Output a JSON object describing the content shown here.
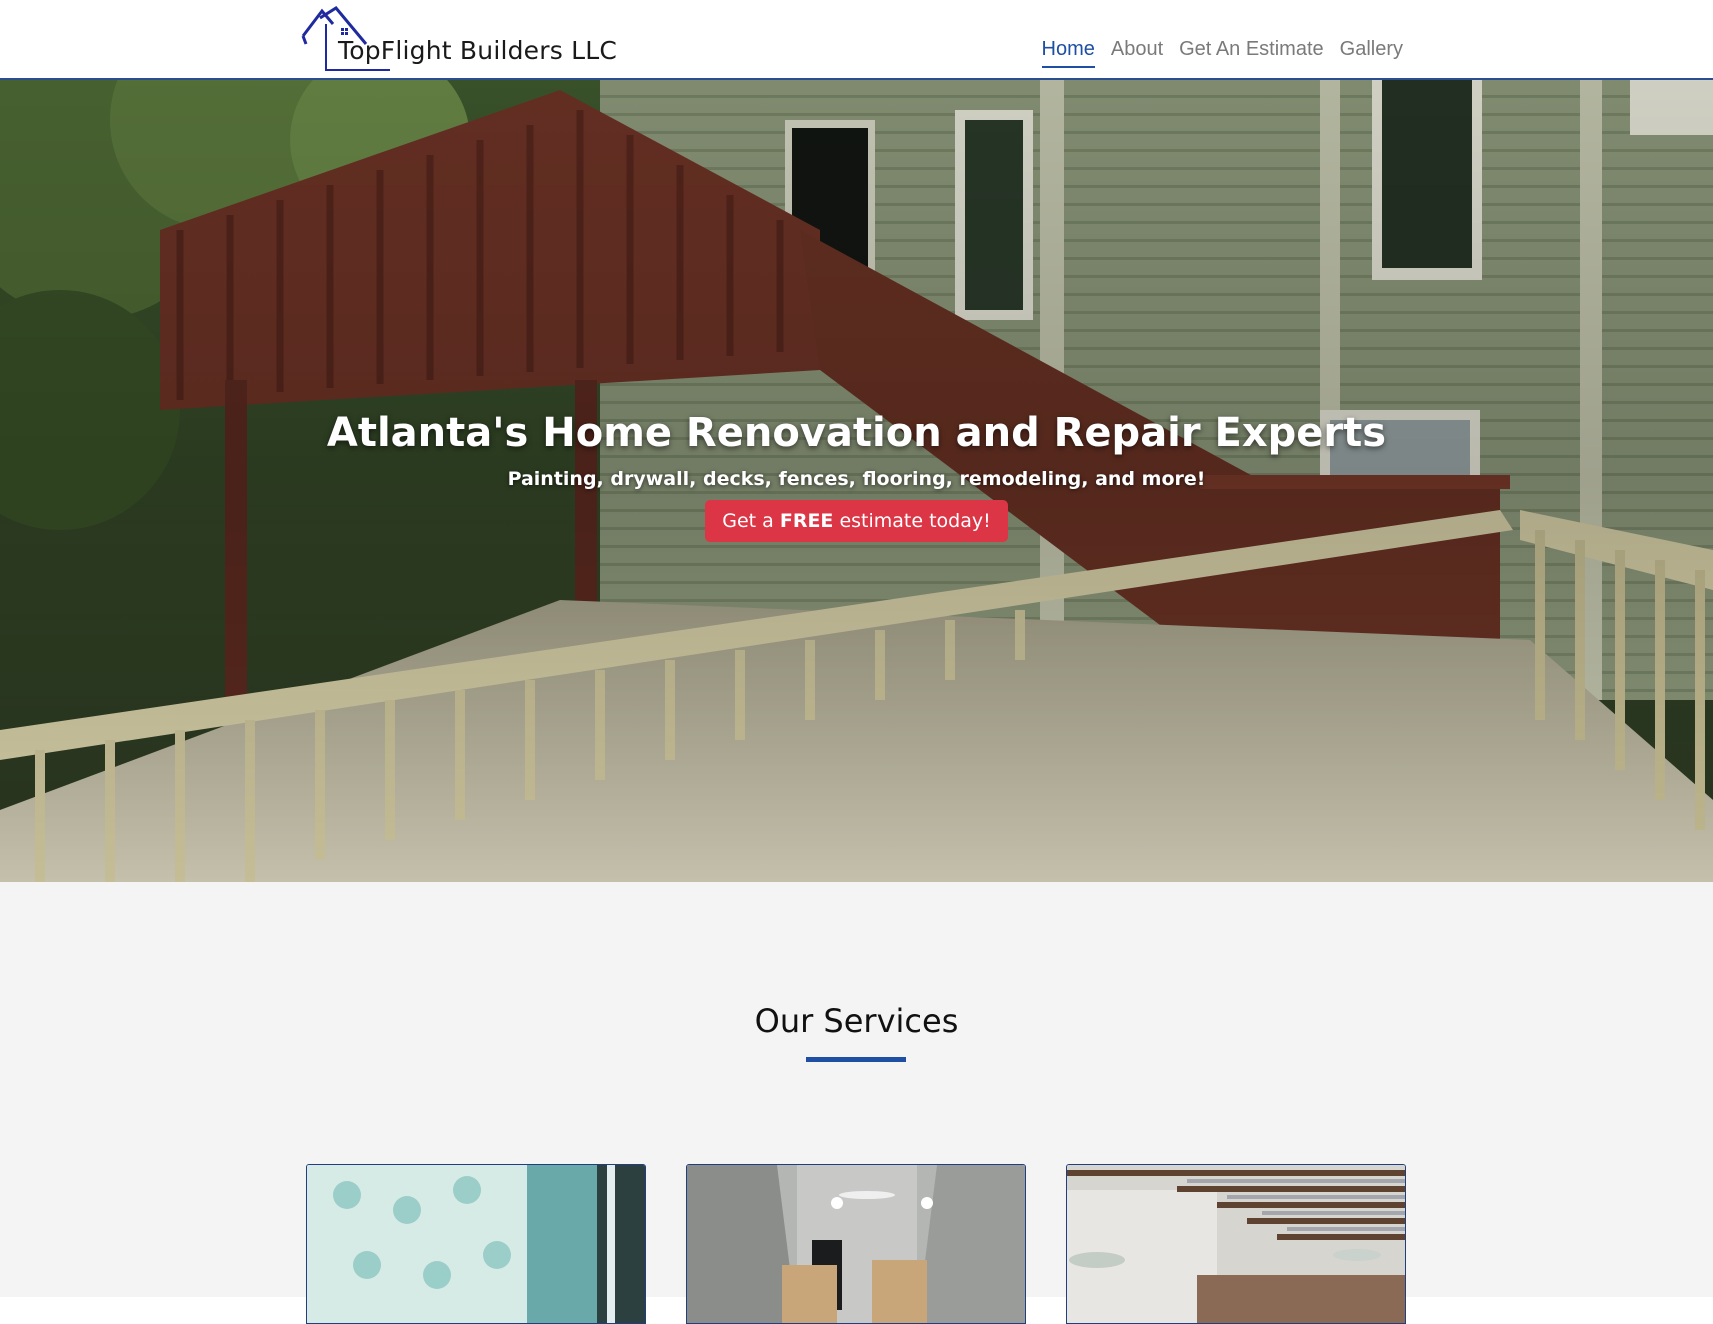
{
  "header": {
    "logo_text": "TopFlight Builders LLC",
    "nav": [
      {
        "label": "Home",
        "active": true
      },
      {
        "label": "About",
        "active": false
      },
      {
        "label": "Get An Estimate",
        "active": false
      },
      {
        "label": "Gallery",
        "active": false
      }
    ]
  },
  "hero": {
    "title": "Atlanta's Home Renovation and Repair Experts",
    "subtitle": "Painting, drywall, decks, fences, flooring, remodeling, and more!",
    "cta_prefix": "Get a ",
    "cta_bold": "FREE",
    "cta_suffix": " estimate today!"
  },
  "services": {
    "title": "Our Services"
  },
  "colors": {
    "brand_blue": "#1f4fa3",
    "cta_red": "#dc3545",
    "section_bg": "#f4f4f4"
  }
}
